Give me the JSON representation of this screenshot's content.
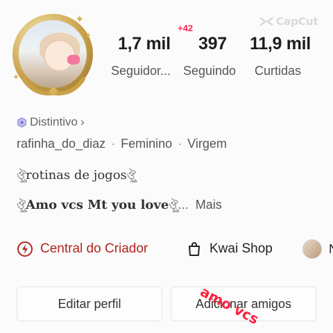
{
  "watermark": {
    "text": "CapCut",
    "icon": "capcut-logo-icon"
  },
  "avatar": {
    "icon": "profile-avatar-gold-frame"
  },
  "stats": {
    "followers_badge": "+42",
    "followers_value": "1,7 mil",
    "followers_label": "Seguidor...",
    "following_value": "397",
    "following_label": "Seguindo",
    "likes_value": "11,9 mil",
    "likes_label": "Curtidas"
  },
  "badge": {
    "label": "Distintivo",
    "chevron": "›",
    "icon": "hexagon-badge-icon"
  },
  "info": {
    "username": "rafinha_do_diaz",
    "gender": "Feminino",
    "sign": "Virgem",
    "separator": "·"
  },
  "bio": {
    "line1_prefix": "ঔৣ",
    "line1_text": "rotinas de jogos",
    "line1_suffix": "ঔৣ",
    "line2_prefix": "ঔৣ",
    "line2_text": "Amo vcs Mt you love",
    "line2_suffix": "ঔৣ...",
    "more_label": "Mais"
  },
  "links": {
    "creator_label": "Central do Criador",
    "creator_icon": "lightning-circle-icon",
    "shop_label": "Kwai Shop",
    "shop_icon": "shopping-bag-icon",
    "third_cut_label": "N"
  },
  "buttons": {
    "edit_label": "Editar perfil",
    "add_label": "Adicionar amigos"
  },
  "overlay": {
    "text": "amo vcs"
  },
  "colors": {
    "accent_red": "#ff2b54",
    "creator_red": "#b3261e",
    "overlay_red": "#ff1f3d",
    "gold": "#c9a14a"
  }
}
